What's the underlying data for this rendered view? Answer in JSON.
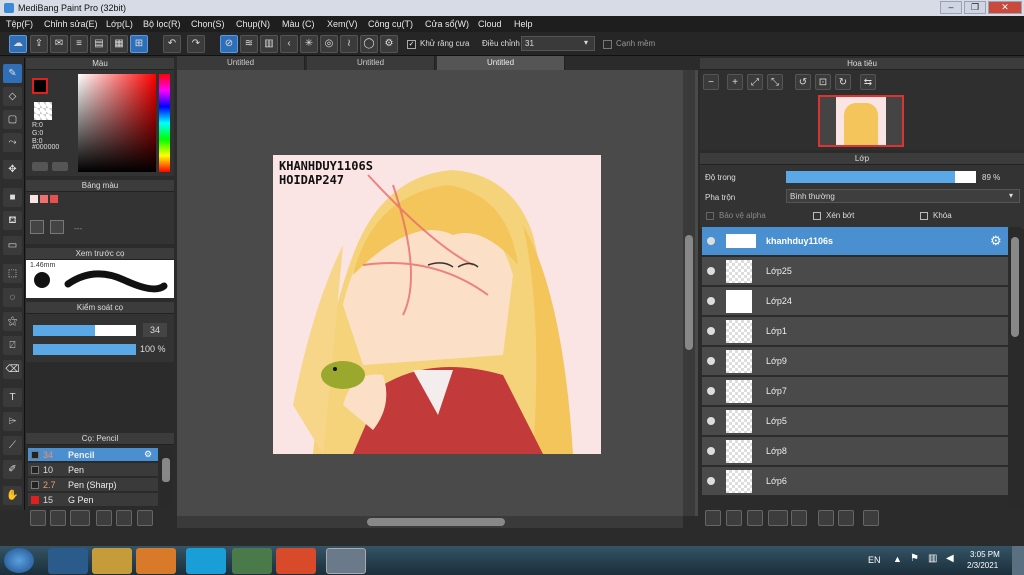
{
  "window": {
    "title": "MediBang Paint Pro (32bit)"
  },
  "menu": [
    "Tệp(F)",
    "Chỉnh sửa(E)",
    "Lớp(L)",
    "Bộ lọc(R)",
    "Chọn(S)",
    "Chụp(N)",
    "Màu (C)",
    "Xem(V)",
    "Công cụ(T)",
    "Cửa sổ(W)",
    "Cloud",
    "Help"
  ],
  "toolbar": {
    "antialias_label": "Khử răng cưa",
    "adjust_label": "Điều chỉnh",
    "adjust_value": "31",
    "snap_label": "Cạnh mềm"
  },
  "color_panel": {
    "title": "Màu",
    "r": "R:0",
    "g": "G:0",
    "b": "B:0",
    "hex": "#000000"
  },
  "palette_panel": {
    "title": "Bảng màu",
    "placeholder": "---"
  },
  "brush_preview": {
    "title": "Xem trước cọ",
    "size": "1.46mm"
  },
  "brush_control": {
    "title": "Kiểm soát cọ",
    "size": "34",
    "opacity": "100 %",
    "size_fill": 0.6,
    "opacity_fill": 1.0
  },
  "brush_list": {
    "title": "Cọ: Pencil",
    "items": [
      {
        "size": "34",
        "name": "Pencil",
        "selected": true,
        "color": "#222222"
      },
      {
        "size": "10",
        "name": "Pen",
        "selected": false,
        "color": "#222222"
      },
      {
        "size": "2.7",
        "name": "Pen (Sharp)",
        "selected": false,
        "color": "#222222"
      },
      {
        "size": "15",
        "name": "G Pen",
        "selected": false,
        "color": "#e02020"
      }
    ]
  },
  "tabs": [
    "Untitled",
    "Untitled",
    "Untitled"
  ],
  "artwork": {
    "watermark_line1": "KHANHDUY1106S",
    "watermark_line2": "HOIDAP247"
  },
  "navigator": {
    "title": "Hoa tiêu"
  },
  "layer_panel": {
    "title": "Lớp",
    "opacity_label": "Độ trong",
    "opacity_value": "89 %",
    "opacity_fill": 0.89,
    "blend_label": "Pha trộn",
    "blend_value": "Bình thường",
    "protect_alpha": "Bảo vệ alpha",
    "clipping": "Xén bớt",
    "lock": "Khóa",
    "layers": [
      {
        "name": "khanhduy1106s",
        "selected": true
      },
      {
        "name": "Lớp25",
        "selected": false
      },
      {
        "name": "Lớp24",
        "selected": false
      },
      {
        "name": "Lớp1",
        "selected": false
      },
      {
        "name": "Lớp9",
        "selected": false
      },
      {
        "name": "Lớp7",
        "selected": false
      },
      {
        "name": "Lớp5",
        "selected": false
      },
      {
        "name": "Lớp8",
        "selected": false
      },
      {
        "name": "Lớp6",
        "selected": false
      }
    ]
  },
  "taskbar": {
    "lang": "EN",
    "time": "3:05 PM",
    "date": "2/3/2021"
  }
}
